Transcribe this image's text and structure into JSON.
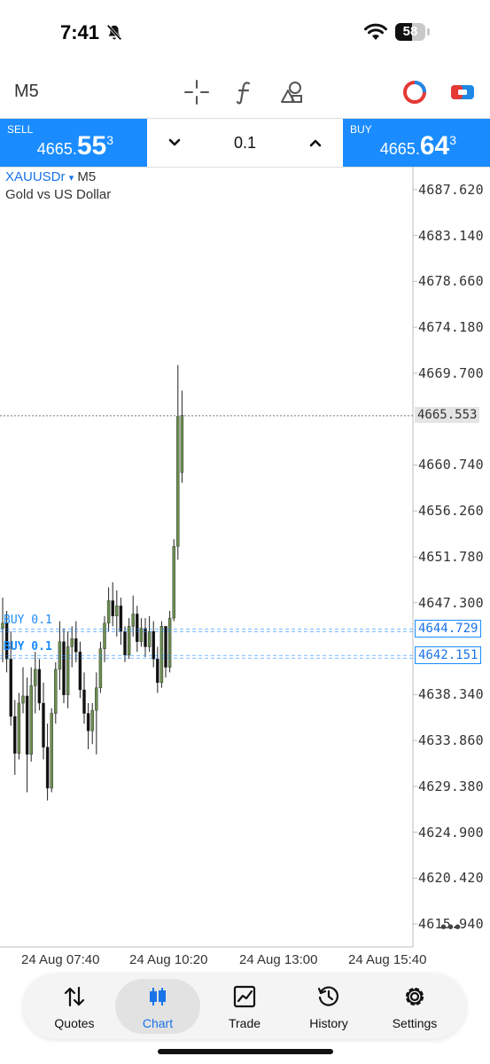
{
  "status_bar": {
    "time": "7:41",
    "battery": "58"
  },
  "toolbar": {
    "timeframe": "M5",
    "tools": [
      "crosshair-icon",
      "indicators-icon",
      "objects-icon",
      "one-click-trading-icon",
      "trade-levels-icon"
    ]
  },
  "trade_panel": {
    "sell": {
      "label": "SELL",
      "price_main": "4665.",
      "price_big": "55",
      "price_sup": "3"
    },
    "buy": {
      "label": "BUY",
      "price_main": "4665.",
      "price_big": "64",
      "price_sup": "3"
    },
    "volume": "0.1"
  },
  "chart": {
    "symbol": "XAUUSDr",
    "symbol_arrow": "▾",
    "timeframe": "M5",
    "description": "Gold vs US Dollar",
    "price_axis": [
      "4687.620",
      "4683.140",
      "4678.660",
      "4674.180",
      "4669.700",
      "4660.740",
      "4656.260",
      "4651.780",
      "4647.300",
      "4638.340",
      "4633.860",
      "4629.380",
      "4624.900",
      "4620.420",
      "4615.940"
    ],
    "current_price": "4665.553",
    "orders": [
      {
        "label": "BUY 0.1",
        "price": "4644.729"
      },
      {
        "label": "BUY 0.1",
        "price": "4642.151"
      }
    ],
    "time_axis": [
      "24 Aug 07:40",
      "24 Aug 10:20",
      "24 Aug 13:00",
      "24 Aug 15:40"
    ],
    "more": "•••",
    "colors": {
      "up": "#6b8e4e",
      "down": "#111111",
      "order": "#1a8cff",
      "accent": "#1a8cff"
    }
  },
  "chart_data": {
    "type": "candlestick",
    "symbol": "XAUUSDr",
    "timeframe": "M5",
    "ylim": [
      4613.7,
      4689.86
    ],
    "candles": [
      {
        "o": 4644.8,
        "h": 4647.8,
        "l": 4641.5,
        "c": 4645.3
      },
      {
        "o": 4645.3,
        "h": 4646.5,
        "l": 4640.5,
        "c": 4641.8
      },
      {
        "o": 4641.8,
        "h": 4644.5,
        "l": 4635.3,
        "c": 4636.2
      },
      {
        "o": 4636.2,
        "h": 4637.8,
        "l": 4630.5,
        "c": 4632.6
      },
      {
        "o": 4632.6,
        "h": 4638.5,
        "l": 4632.0,
        "c": 4637.5
      },
      {
        "o": 4637.5,
        "h": 4641.0,
        "l": 4636.5,
        "c": 4638.2
      },
      {
        "o": 4638.2,
        "h": 4640.0,
        "l": 4628.8,
        "c": 4632.5
      },
      {
        "o": 4632.5,
        "h": 4641.0,
        "l": 4631.8,
        "c": 4639.2
      },
      {
        "o": 4639.2,
        "h": 4642.5,
        "l": 4636.5,
        "c": 4640.8
      },
      {
        "o": 4640.8,
        "h": 4641.8,
        "l": 4636.8,
        "c": 4637.5
      },
      {
        "o": 4637.5,
        "h": 4639.5,
        "l": 4632.0,
        "c": 4633.2
      },
      {
        "o": 4633.2,
        "h": 4635.5,
        "l": 4628.0,
        "c": 4629.2
      },
      {
        "o": 4629.2,
        "h": 4637.0,
        "l": 4628.8,
        "c": 4636.5
      },
      {
        "o": 4636.5,
        "h": 4641.5,
        "l": 4635.5,
        "c": 4640.8
      },
      {
        "o": 4640.8,
        "h": 4645.5,
        "l": 4638.8,
        "c": 4643.5
      },
      {
        "o": 4643.5,
        "h": 4644.8,
        "l": 4637.5,
        "c": 4638.3
      },
      {
        "o": 4638.3,
        "h": 4644.5,
        "l": 4637.0,
        "c": 4643.0
      },
      {
        "o": 4643.0,
        "h": 4645.0,
        "l": 4641.0,
        "c": 4643.8
      },
      {
        "o": 4643.8,
        "h": 4645.5,
        "l": 4641.5,
        "c": 4642.5
      },
      {
        "o": 4642.5,
        "h": 4643.5,
        "l": 4638.0,
        "c": 4638.8
      },
      {
        "o": 4638.8,
        "h": 4640.5,
        "l": 4635.5,
        "c": 4636.5
      },
      {
        "o": 4636.5,
        "h": 4637.5,
        "l": 4633.0,
        "c": 4634.8
      },
      {
        "o": 4634.8,
        "h": 4637.5,
        "l": 4633.5,
        "c": 4636.8
      },
      {
        "o": 4636.8,
        "h": 4640.5,
        "l": 4632.5,
        "c": 4639.0
      },
      {
        "o": 4639.0,
        "h": 4643.5,
        "l": 4638.5,
        "c": 4642.8
      },
      {
        "o": 4642.8,
        "h": 4646.0,
        "l": 4641.5,
        "c": 4645.3
      },
      {
        "o": 4645.3,
        "h": 4648.8,
        "l": 4644.5,
        "c": 4647.5
      },
      {
        "o": 4647.5,
        "h": 4649.3,
        "l": 4645.0,
        "c": 4646.0
      },
      {
        "o": 4646.0,
        "h": 4648.5,
        "l": 4644.0,
        "c": 4647.0
      },
      {
        "o": 4647.0,
        "h": 4647.8,
        "l": 4643.2,
        "c": 4644.5
      },
      {
        "o": 4644.5,
        "h": 4645.0,
        "l": 4641.5,
        "c": 4642.2
      },
      {
        "o": 4642.2,
        "h": 4645.8,
        "l": 4641.8,
        "c": 4645.0
      },
      {
        "o": 4645.0,
        "h": 4648.0,
        "l": 4644.0,
        "c": 4646.2
      },
      {
        "o": 4646.2,
        "h": 4647.0,
        "l": 4642.5,
        "c": 4643.5
      },
      {
        "o": 4643.5,
        "h": 4645.8,
        "l": 4643.0,
        "c": 4644.8
      },
      {
        "o": 4644.8,
        "h": 4645.8,
        "l": 4642.0,
        "c": 4643.0
      },
      {
        "o": 4643.0,
        "h": 4646.0,
        "l": 4642.5,
        "c": 4644.5
      },
      {
        "o": 4644.5,
        "h": 4645.5,
        "l": 4641.0,
        "c": 4641.8
      },
      {
        "o": 4641.8,
        "h": 4643.0,
        "l": 4638.5,
        "c": 4639.5
      },
      {
        "o": 4639.5,
        "h": 4645.5,
        "l": 4639.0,
        "c": 4645.0
      },
      {
        "o": 4645.0,
        "h": 4644.6,
        "l": 4640.0,
        "c": 4641.0
      },
      {
        "o": 4641.0,
        "h": 4646.5,
        "l": 4640.5,
        "c": 4645.8
      },
      {
        "o": 4645.8,
        "h": 4653.5,
        "l": 4645.5,
        "c": 4652.8
      },
      {
        "o": 4652.8,
        "h": 4670.5,
        "l": 4651.5,
        "c": 4665.5
      },
      {
        "o": 4660.0,
        "h": 4668.0,
        "l": 4659.0,
        "c": 4665.6
      }
    ]
  },
  "nav": {
    "items": [
      {
        "label": "Quotes",
        "icon": "quotes-icon"
      },
      {
        "label": "Chart",
        "icon": "chart-icon"
      },
      {
        "label": "Trade",
        "icon": "trade-icon"
      },
      {
        "label": "History",
        "icon": "history-icon"
      },
      {
        "label": "Settings",
        "icon": "settings-icon"
      }
    ],
    "active": "Chart"
  }
}
